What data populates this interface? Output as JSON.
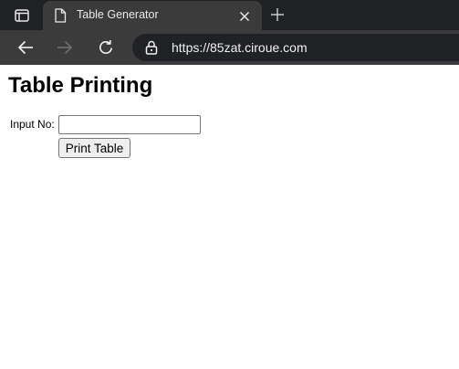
{
  "browser": {
    "tab": {
      "title": "Table Generator"
    },
    "address_bar": {
      "url": "https://85zat.ciroue.com"
    },
    "icons": {
      "window": "window-icon",
      "page": "page-icon",
      "close": "close-icon",
      "new_tab": "plus-icon",
      "back": "back-arrow-icon",
      "forward": "forward-arrow-icon",
      "reload": "reload-icon",
      "lock": "lock-icon"
    },
    "colors": {
      "tabstrip": "#202124",
      "toolbar": "#3b3b3b",
      "omnibox": "#202124"
    }
  },
  "page": {
    "title": "Table Printing",
    "form": {
      "input_label": "Input No:",
      "input_value": "",
      "input_placeholder": "",
      "button_label": "Print Table"
    }
  }
}
